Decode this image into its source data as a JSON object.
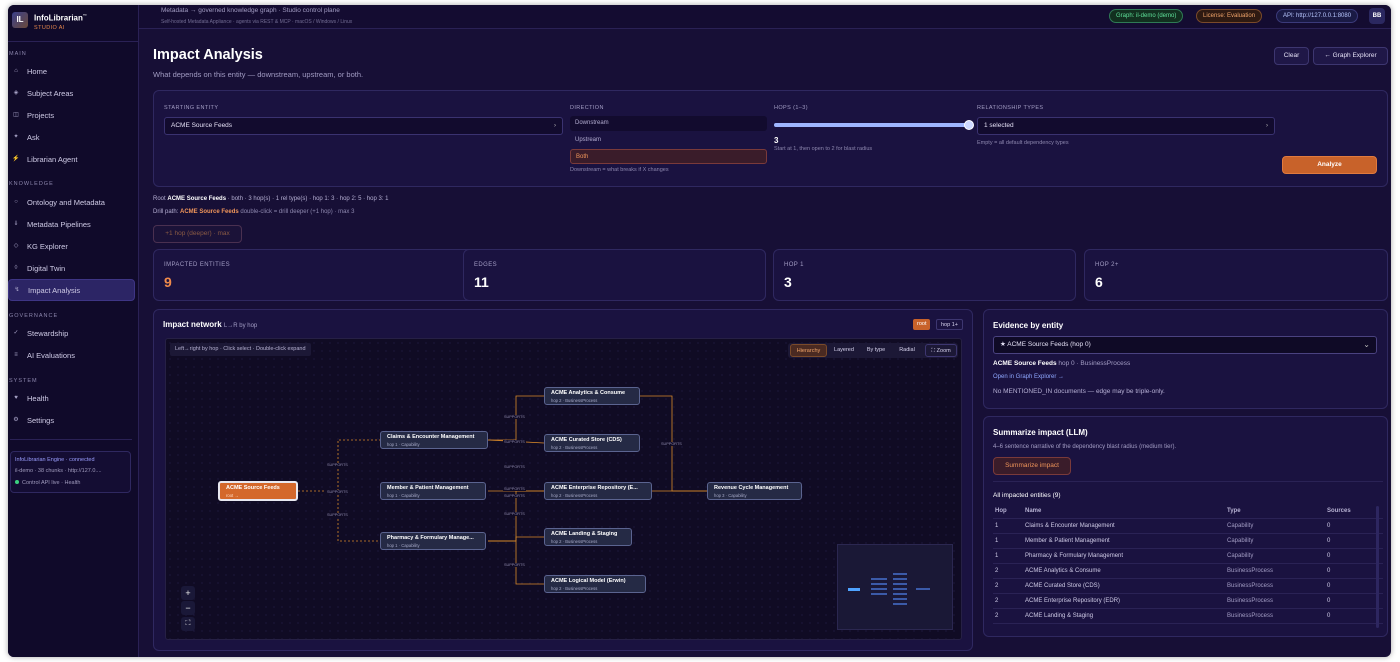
{
  "app": {
    "name": "InfoLibrarian",
    "tm": "™",
    "subtitle": "STUDIO AI",
    "logo": "IL"
  },
  "sidebar": {
    "sections": {
      "main": "MAIN",
      "knowledge": "KNOWLEDGE",
      "governance": "GOVERNANCE",
      "system": "SYSTEM"
    },
    "items": [
      {
        "label": "Home",
        "icon": "⌂"
      },
      {
        "label": "Subject Areas",
        "icon": "◈"
      },
      {
        "label": "Projects",
        "icon": "◫"
      },
      {
        "label": "Ask",
        "icon": "✦"
      },
      {
        "label": "Librarian Agent",
        "icon": "⚡"
      },
      {
        "label": "Ontology and Metadata",
        "icon": "○"
      },
      {
        "label": "Metadata Pipelines",
        "icon": "⇓"
      },
      {
        "label": "KG Explorer",
        "icon": "◇"
      },
      {
        "label": "Digital Twin",
        "icon": "◊"
      },
      {
        "label": "Impact Analysis",
        "icon": "↯"
      },
      {
        "label": "Stewardship",
        "icon": "✓"
      },
      {
        "label": "AI Evaluations",
        "icon": "≡"
      },
      {
        "label": "Health",
        "icon": "♥"
      },
      {
        "label": "Settings",
        "icon": "⚙"
      }
    ],
    "engine": {
      "title": "InfoLibrarian Engine",
      "status": "· connected",
      "detail": "il-demo · 38 chunks · http://127.0....",
      "api": "Control API live · Health"
    }
  },
  "topbar": {
    "line1": "Metadata → governed knowledge graph · Studio control plane",
    "line2": "Self-hosted Metadata Appliance · agents via REST & MCP · macOS / Windows / Linux",
    "graph_pill": "Graph: il-demo (demo)",
    "license_pill": "License: Evaluation",
    "api_pill": "API: http://127.0.0.1:8080",
    "avatar": "BB"
  },
  "page": {
    "title": "Impact Analysis",
    "subtitle": "What depends on this entity — downstream, upstream, or both.",
    "clear": "Clear",
    "graph_explorer": "← Graph Explorer"
  },
  "form": {
    "starting_entity_label": "STARTING ENTITY",
    "starting_entity": "ACME Source Feeds",
    "direction_label": "DIRECTION",
    "directions": [
      "Downstream",
      "Upstream",
      "Both"
    ],
    "direction_selected": "Both",
    "direction_hint": "Downstream = what breaks if X changes",
    "hops_label": "HOPS (1–3)",
    "hops_value": "3",
    "hops_fraction": 1.0,
    "hops_hint": "Start at 1, then open to 2 for blast radius",
    "rel_label": "RELATIONSHIP TYPES",
    "rel_value": "1 selected",
    "rel_hint": "Empty = all default dependency types",
    "analyze": "Analyze"
  },
  "summary": {
    "root_prefix": "Root",
    "root": "ACME Source Feeds",
    "rest": "·  both  ·  3 hop(s)  ·  1 rel type(s)  ·  hop 1: 3 · hop 2: 5 · hop 3: 1",
    "drill_prefix": "Drill path:",
    "drill_entity": "ACME Source Feeds",
    "drill_rest": "double-click = drill deeper (+1 hop) · max 3",
    "deeper_button": "+1 hop (deeper) · max"
  },
  "stats": [
    {
      "label": "IMPACTED ENTITIES",
      "value": "9",
      "color": "#f08a4b"
    },
    {
      "label": "EDGES",
      "value": "11",
      "color": "#ffffff"
    },
    {
      "label": "HOP 1",
      "value": "3",
      "color": "#ffffff"
    },
    {
      "label": "HOP 2+",
      "value": "6",
      "color": "#ffffff"
    }
  ],
  "network": {
    "title": "Impact network",
    "subtitle": "L→R by hop",
    "root_badge": "root",
    "hop_badge": "hop 1+",
    "hint": "Left→right by hop · Click select · Double-click expand",
    "layouts": [
      "Hierarchy",
      "Layered",
      "By type",
      "Radial"
    ],
    "zoom": "⛶ Zoom",
    "edge_label": "SUPPORTS",
    "nodes": [
      {
        "name": "ACME Source Feeds",
        "meta": "root →"
      },
      {
        "name": "Claims & Encounter Management",
        "meta": "hop 1 · Capability"
      },
      {
        "name": "Member & Patient Management",
        "meta": "hop 1 · Capability"
      },
      {
        "name": "Pharmacy & Formulary Manage...",
        "meta": "hop 1 · Capability"
      },
      {
        "name": "ACME Analytics & Consume",
        "meta": "hop 2 · BusinessProcess"
      },
      {
        "name": "ACME Curated Store (CDS)",
        "meta": "hop 2 · BusinessProcess"
      },
      {
        "name": "ACME Enterprise Repository (E...",
        "meta": "hop 2 · BusinessProcess"
      },
      {
        "name": "ACME Landing & Staging",
        "meta": "hop 2 · BusinessProcess"
      },
      {
        "name": "ACME Logical Model (Erwin)",
        "meta": "hop 2 · BusinessProcess"
      },
      {
        "name": "Revenue Cycle Management",
        "meta": "hop 3 · Capability"
      }
    ],
    "zoom_controls": [
      "+",
      "−",
      "⛶"
    ]
  },
  "evidence": {
    "title": "Evidence by entity",
    "select": "★ ACME Source Feeds (hop 0)",
    "entity": "ACME Source Feeds",
    "entity_meta": "hop 0 · BusinessProcess",
    "link": "Open in Graph Explorer →",
    "note": "No MENTIONED_IN documents — edge may be triple-only."
  },
  "summarize": {
    "title": "Summarize impact (LLM)",
    "desc": "4–6 sentence narrative of the dependency blast radius (medium tier).",
    "button": "Summarize impact",
    "table_title": "All impacted entities (9)",
    "columns": [
      "Hop",
      "Name",
      "Type",
      "Sources"
    ],
    "rows": [
      [
        "1",
        "Claims & Encounter Management",
        "Capability",
        "0"
      ],
      [
        "1",
        "Member & Patient Management",
        "Capability",
        "0"
      ],
      [
        "1",
        "Pharmacy & Formulary Management",
        "Capability",
        "0"
      ],
      [
        "2",
        "ACME Analytics & Consume",
        "BusinessProcess",
        "0"
      ],
      [
        "2",
        "ACME Curated Store (CDS)",
        "BusinessProcess",
        "0"
      ],
      [
        "2",
        "ACME Enterprise Repository (EDR)",
        "BusinessProcess",
        "0"
      ],
      [
        "2",
        "ACME Landing & Staging",
        "BusinessProcess",
        "0"
      ]
    ]
  }
}
